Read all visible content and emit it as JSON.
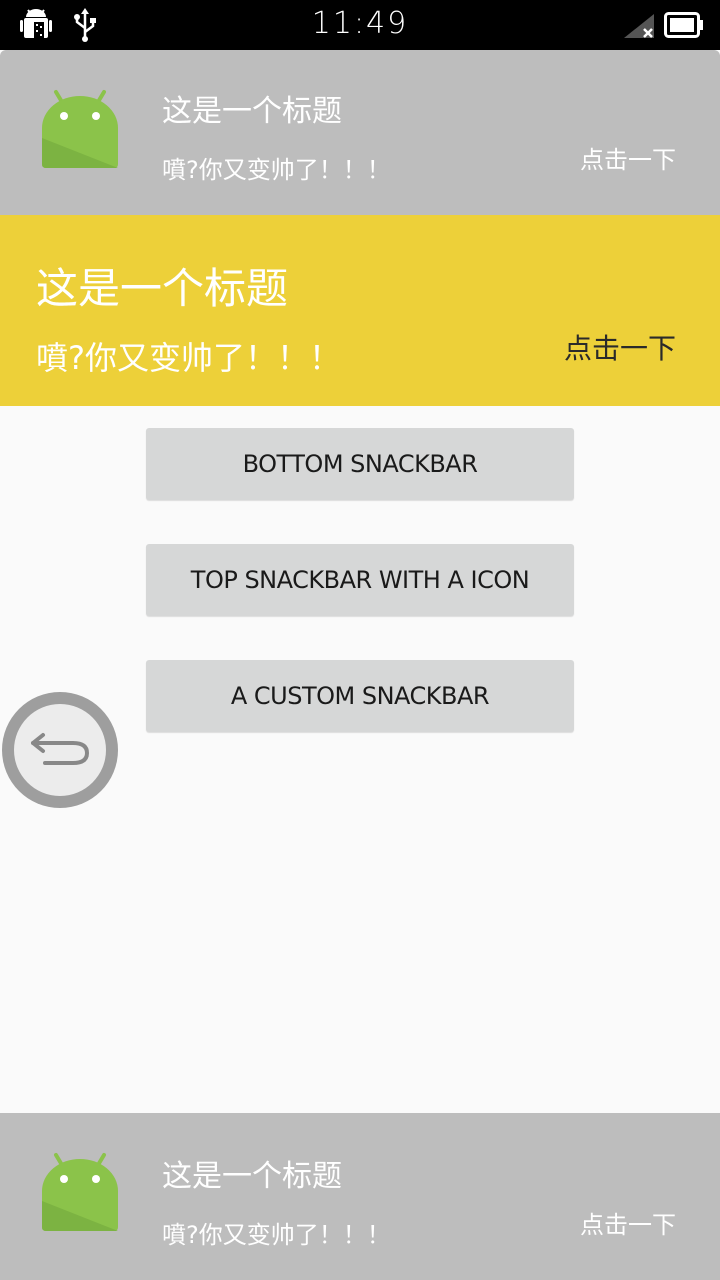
{
  "status_bar": {
    "time": "11:49",
    "icons": [
      "android-debug-icon",
      "usb-icon",
      "signal-off-icon",
      "battery-icon"
    ]
  },
  "top_snackbar": {
    "icon": "android-robot-icon",
    "title": "这是一个标题",
    "message": "噴?你又变帅了！！！",
    "action": "点击一下"
  },
  "custom_snackbar": {
    "title": "这是一个标题",
    "message": "噴?你又变帅了！！！",
    "action": "点击一下",
    "background_color": "#edd039"
  },
  "buttons": {
    "bottom_snackbar": "BOTTOM SNACKBAR",
    "top_snackbar_icon": "TOP SNACKBAR WITH A ICON",
    "custom_snackbar": "A CUSTOM SNACKBAR"
  },
  "floating_button": {
    "icon": "back-arrow-icon"
  },
  "bottom_snackbar": {
    "icon": "android-robot-icon",
    "title": "这是一个标题",
    "message": "噴?你又变帅了！！！",
    "action": "点击一下"
  }
}
